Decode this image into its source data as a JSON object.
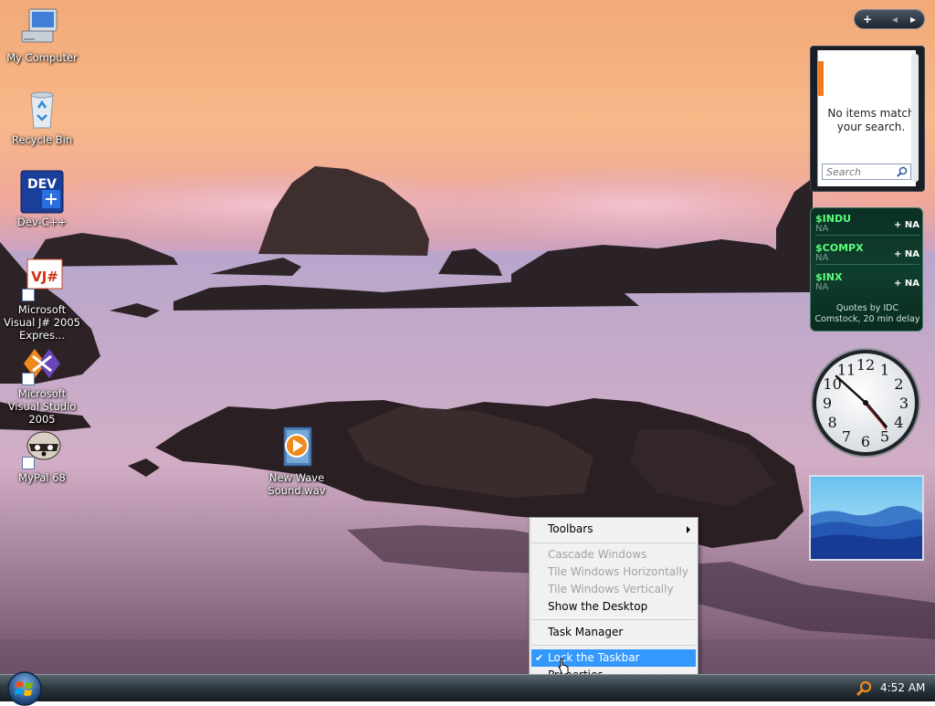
{
  "desktop_icons": [
    {
      "label": "My Computer",
      "icon": "my-computer-icon"
    },
    {
      "label": "Recycle Bin",
      "icon": "recycle-bin-icon"
    },
    {
      "label": "Dev-C++",
      "icon": "dev-cpp-icon",
      "badge": "DEV"
    },
    {
      "label": "Microsoft Visual J# 2005 Expres...",
      "icon": "visual-jsharp-icon",
      "badge": "VJ#"
    },
    {
      "label": "Microsoft Visual Studio 2005",
      "icon": "visual-studio-icon"
    },
    {
      "label": "MyPal 68",
      "icon": "mypal-icon"
    },
    {
      "label": "New Wave Sound.wav",
      "icon": "wave-sound-file-icon"
    }
  ],
  "sidebar": {
    "controls": {
      "add": "+",
      "prev": "◂",
      "next": "▸"
    },
    "contacts": {
      "message": "No items match your search.",
      "search_placeholder": "Search"
    },
    "stocks": {
      "items": [
        {
          "symbol": "$INDU",
          "value": "NA",
          "change": "+ NA"
        },
        {
          "symbol": "$COMPX",
          "value": "NA",
          "change": "+ NA"
        },
        {
          "symbol": "$INX",
          "value": "NA",
          "change": "+ NA"
        }
      ],
      "note": "Quotes by IDC Comstock, 20 min delay"
    },
    "clock": {
      "numbers": [
        "12",
        "1",
        "2",
        "3",
        "4",
        "5",
        "6",
        "7",
        "8",
        "9",
        "10",
        "11"
      ]
    }
  },
  "context_menu": {
    "toolbars": "Toolbars",
    "cascade": "Cascade Windows",
    "tile_h": "Tile Windows Horizontally",
    "tile_v": "Tile Windows Vertically",
    "show_desktop": "Show the Desktop",
    "task_manager": "Task Manager",
    "lock_taskbar": "Lock the Taskbar",
    "properties": "Properties",
    "lock_checked_mark": "✔"
  },
  "taskbar": {
    "clock": "4:52 AM"
  },
  "colors": {
    "menu_highlight": "#3399ff",
    "stock_symbol": "#5cff7a",
    "tray_search": "#f08a1c"
  }
}
